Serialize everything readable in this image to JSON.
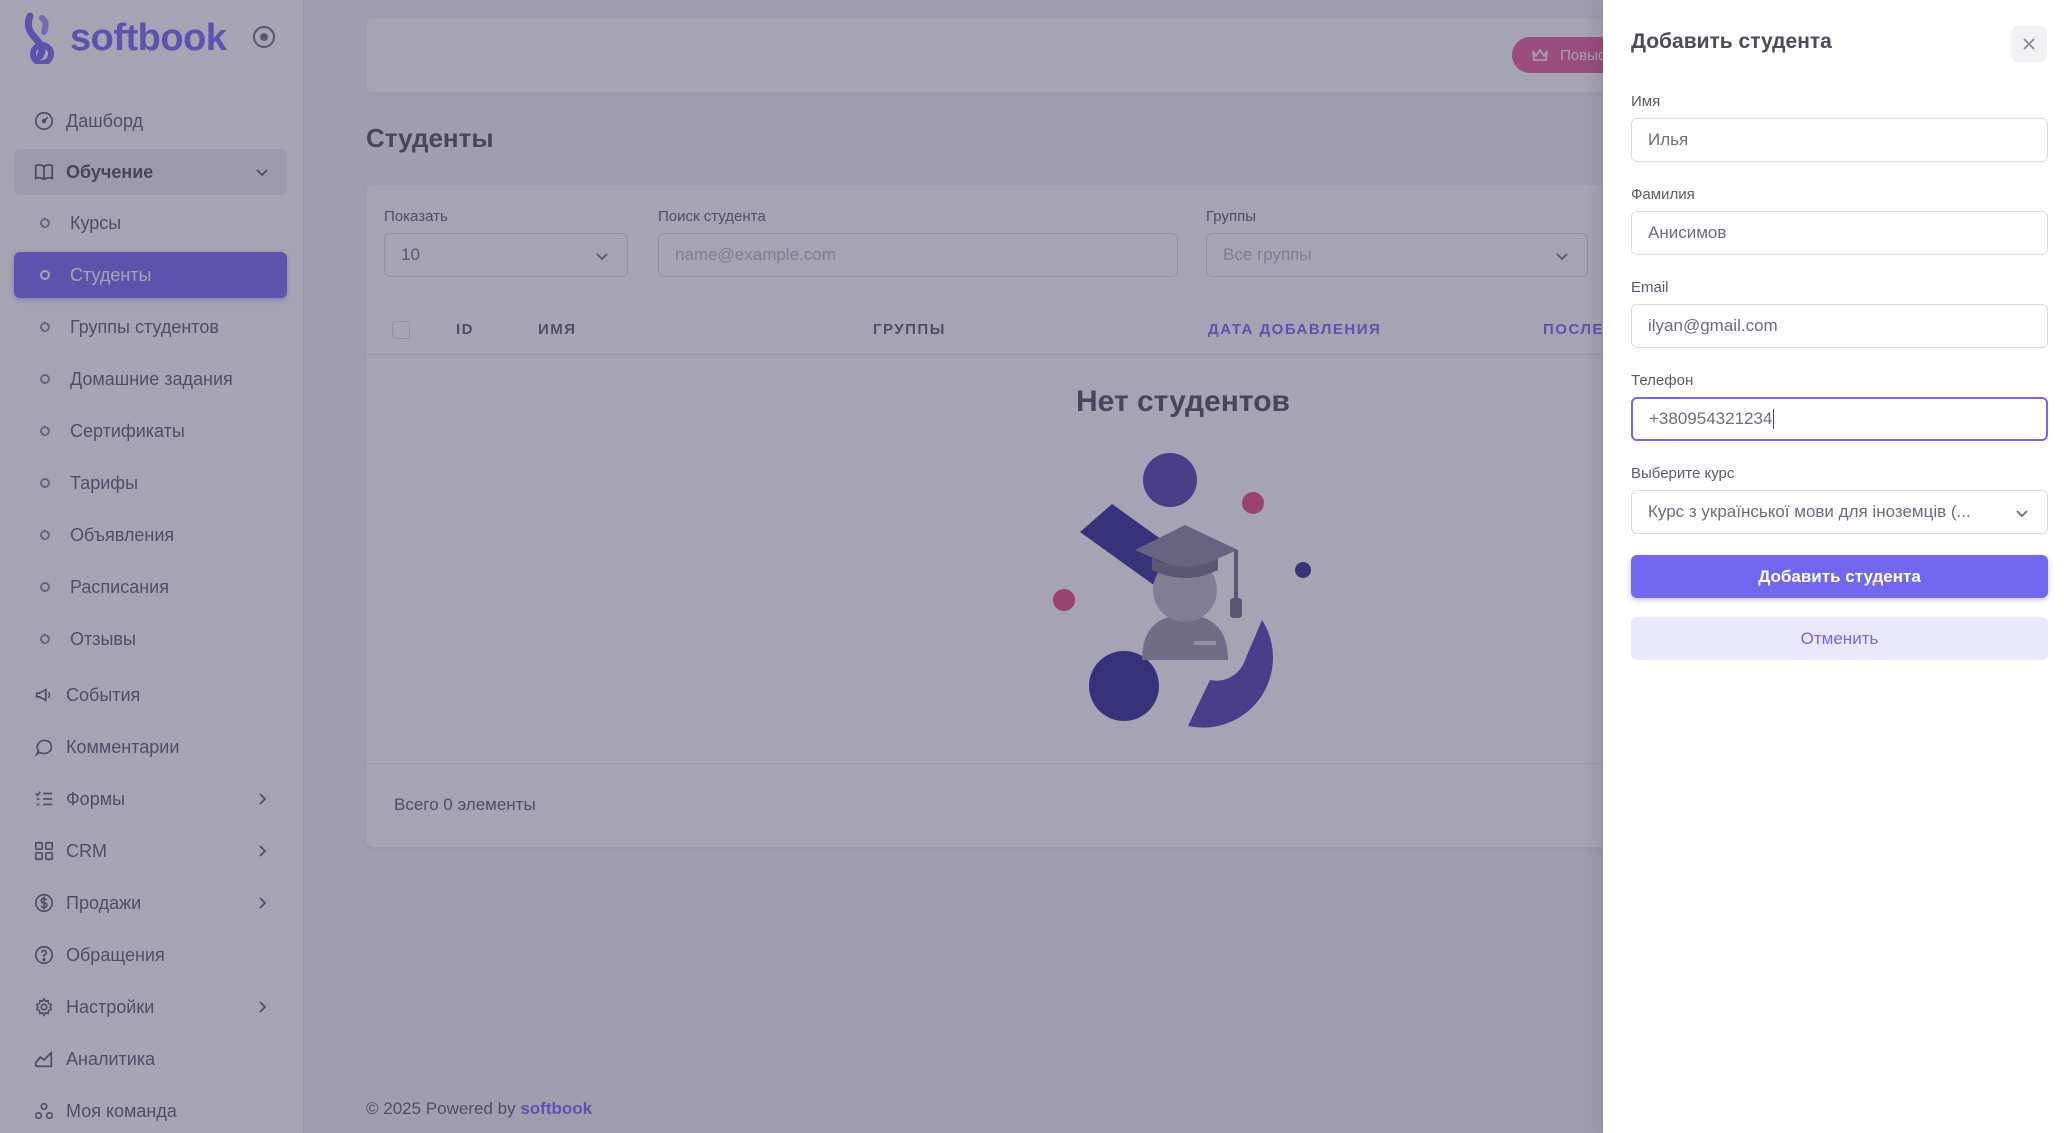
{
  "brand": {
    "name": "softbook"
  },
  "sidebar": {
    "items": [
      {
        "label": "Дашборд"
      },
      {
        "label": "Обучение"
      },
      {
        "label": "Курсы"
      },
      {
        "label": "Студенты"
      },
      {
        "label": "Группы студентов"
      },
      {
        "label": "Домашние задания"
      },
      {
        "label": "Сертификаты"
      },
      {
        "label": "Тарифы"
      },
      {
        "label": "Объявления"
      },
      {
        "label": "Расписания"
      },
      {
        "label": "Отзывы"
      },
      {
        "label": "События"
      },
      {
        "label": "Комментарии"
      },
      {
        "label": "Формы"
      },
      {
        "label": "CRM"
      },
      {
        "label": "Продажи"
      },
      {
        "label": "Обращения"
      },
      {
        "label": "Настройки"
      },
      {
        "label": "Аналитика"
      },
      {
        "label": "Моя команда"
      }
    ]
  },
  "topbar": {
    "upgrade_label": "Повысить"
  },
  "page": {
    "title": "Студенты"
  },
  "filters": {
    "show_label": "Показать",
    "show_value": "10",
    "search_label": "Поиск студента",
    "search_placeholder": "name@example.com",
    "groups_label": "Группы",
    "groups_value": "Все группы"
  },
  "table": {
    "columns": [
      "ID",
      "ИМЯ",
      "ГРУППЫ",
      "ДАТА ДОБАВЛЕНИЯ",
      "ПОСЛЕ"
    ],
    "empty_title": "Нет студентов",
    "total_text": "Всего 0 элементы"
  },
  "footer": {
    "copyright_prefix": "© 2025 Powered by",
    "brand": "softbook"
  },
  "drawer": {
    "title": "Добавить студента",
    "first_name_label": "Имя",
    "first_name_value": "Илья",
    "last_name_label": "Фамилия",
    "last_name_value": "Анисимов",
    "email_label": "Email",
    "email_value": "ilyan@gmail.com",
    "phone_label": "Телефон",
    "phone_value": "+380954321234",
    "course_label": "Выберите курс",
    "course_value": "Курс з української мови для іноземців (...",
    "submit_label": "Добавить студента",
    "cancel_label": "Отменить"
  },
  "colors": {
    "accent": "#7367f0",
    "pink": "#ea5a9a",
    "overlay": "#463e64"
  }
}
